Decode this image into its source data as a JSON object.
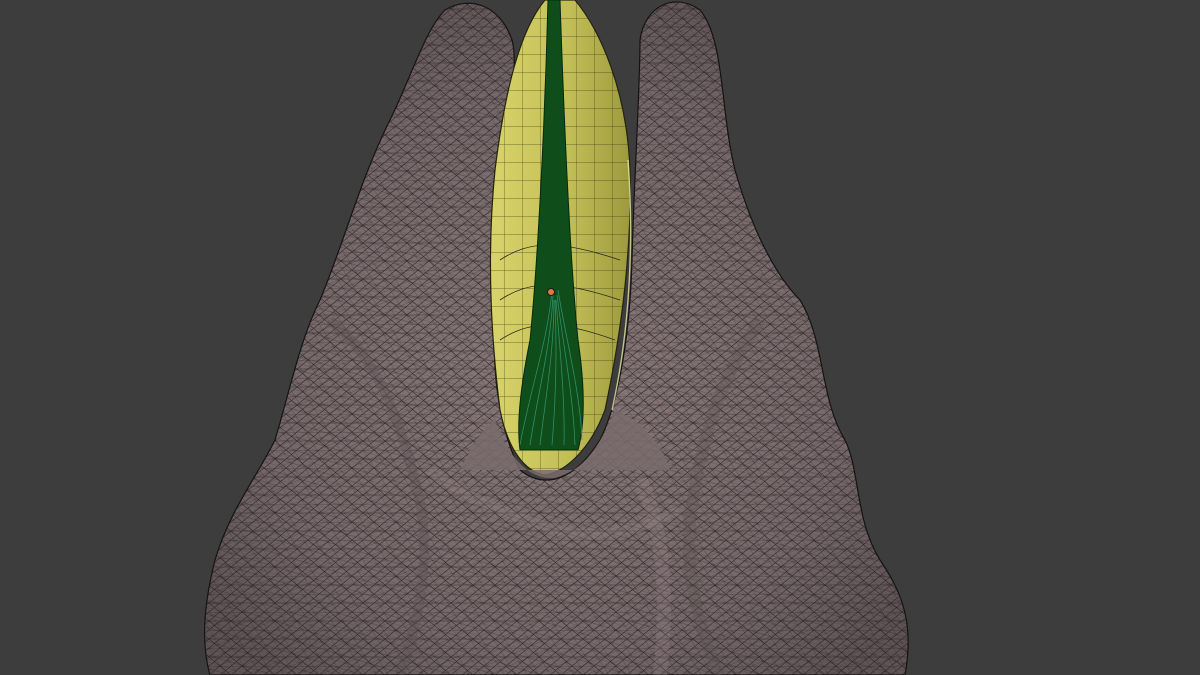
{
  "viewport": {
    "background_color": "#3d3d3d",
    "shading": "solid-with-wireframe"
  },
  "scene": {
    "objects": [
      {
        "name": "rock-mesh",
        "color": "#7c6d6e",
        "wire_color": "#1a1616"
      },
      {
        "name": "outer-sheath-mesh",
        "color": "#c7c35a",
        "wire_color": "#2a2a14"
      },
      {
        "name": "inner-core-mesh",
        "color": "#0f4d1a",
        "wire_color": "#2f8f6a"
      }
    ],
    "origin_marker_color": "#e07a45"
  }
}
